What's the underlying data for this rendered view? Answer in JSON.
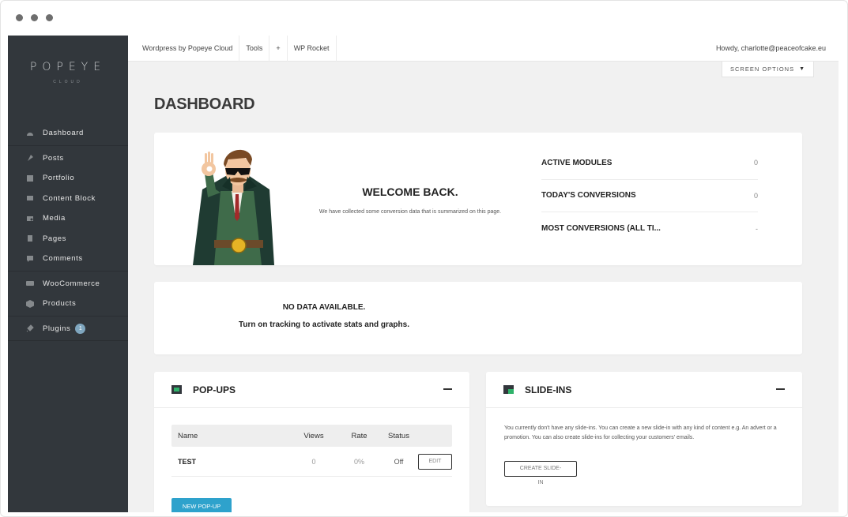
{
  "sidebar": {
    "logo": "POPEYE",
    "logo_sub": "CLOUD",
    "items": [
      {
        "label": "Dashboard"
      },
      {
        "label": "Posts"
      },
      {
        "label": "Portfolio"
      },
      {
        "label": "Content Block"
      },
      {
        "label": "Media"
      },
      {
        "label": "Pages"
      },
      {
        "label": "Comments"
      },
      {
        "label": "WooCommerce"
      },
      {
        "label": "Products"
      },
      {
        "label": "Plugins",
        "badge": "1"
      }
    ]
  },
  "topbar": {
    "site": "Wordpress by Popeye Cloud",
    "tools": "Tools",
    "plus": "+",
    "rocket": "WP Rocket",
    "howdy": "Howdy, charlotte@peaceofcake.eu"
  },
  "screen_options": "SCREEN OPTIONS",
  "page_title": "DASHBOARD",
  "welcome": {
    "title": "WELCOME BACK.",
    "subtitle": "We have collected some conversion data that is summarized on this page.",
    "stats": [
      {
        "label": "ACTIVE MODULES",
        "value": "0"
      },
      {
        "label": "TODAY'S CONVERSIONS",
        "value": "0"
      },
      {
        "label": "MOST CONVERSIONS (ALL TI...",
        "value": "-"
      }
    ]
  },
  "nodata": {
    "title": "NO DATA AVAILABLE.",
    "subtitle": "Turn on tracking to activate stats and graphs."
  },
  "popups": {
    "title": "POP-UPS",
    "columns": {
      "name": "Name",
      "views": "Views",
      "rate": "Rate",
      "status": "Status"
    },
    "rows": [
      {
        "name": "TEST",
        "views": "0",
        "rate": "0%",
        "status": "Off",
        "action": "EDIT"
      }
    ],
    "new_button": "NEW POP-UP"
  },
  "slideins": {
    "title": "SLIDE-INS",
    "text": "You currently don't have any slide-ins. You can create a new slide-in with any kind of content e.g. An advert or a promotion. You can also create slide-ins for collecting your customers' emails.",
    "button_line1": "CREATE SLIDE-",
    "button_line2": "IN"
  },
  "colors": {
    "sidebar_bg": "#32373c",
    "content_bg": "#f1f1f1",
    "accent_blue": "#2ea2cc",
    "badge_blue": "#7fa6bf",
    "module_icon_green": "#2fb26a"
  }
}
